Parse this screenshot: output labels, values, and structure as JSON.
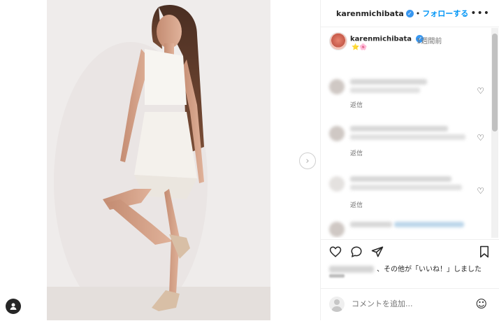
{
  "post": {
    "username": "karenmichibata",
    "follow_label": "フォローする",
    "separator": "•",
    "more_icon": "more-options-icon"
  },
  "caption": {
    "username": "karenmichibata",
    "time_ago": "1週間前",
    "emoji_text": "⭐🌸"
  },
  "comments": [
    {
      "reply_label": "返信"
    },
    {
      "reply_label": "返信"
    },
    {
      "reply_label": "返信"
    }
  ],
  "likes": {
    "text": "、その他が「いいね！」しました"
  },
  "comment_box": {
    "placeholder": "コメントを追加..."
  },
  "colors": {
    "accent": "#0095f6",
    "verified": "#3897f0",
    "text": "#262626",
    "muted": "#737373"
  }
}
